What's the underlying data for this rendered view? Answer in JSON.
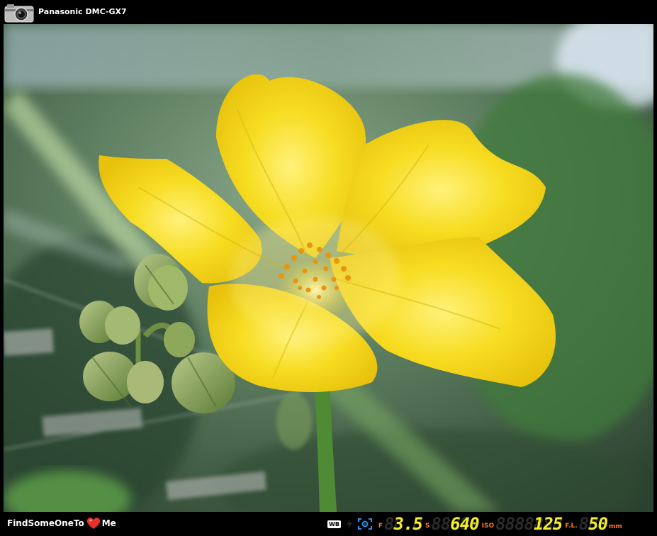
{
  "header": {
    "camera_model": "Panasonic DMC-GX7",
    "icon": "camera-icon"
  },
  "footer": {
    "brand_left": "FindSomeOneTo",
    "brand_right": "Me",
    "brand_icon": "heart-icon",
    "brand_icon_color": "#e8302a"
  },
  "exif": {
    "wb_label": "WB",
    "flash_icon": "flash-icon",
    "metering_icon": "metering-icon",
    "aperture_label": "F",
    "aperture_ghost": "88.8",
    "aperture_value": "3.5",
    "shutter_label": "S",
    "shutter_ghost": "88888",
    "shutter_value": "640",
    "iso_label": "ISO",
    "iso_ghost": "8888888",
    "iso_value": "125",
    "focal_label": "F.L.",
    "focal_ghost": "888",
    "focal_value": "50",
    "focal_unit": "mm",
    "value_color": "#f5ef1e",
    "label_color": "#ff7a22"
  },
  "photo": {
    "subject": "yellow-flower-photo"
  }
}
